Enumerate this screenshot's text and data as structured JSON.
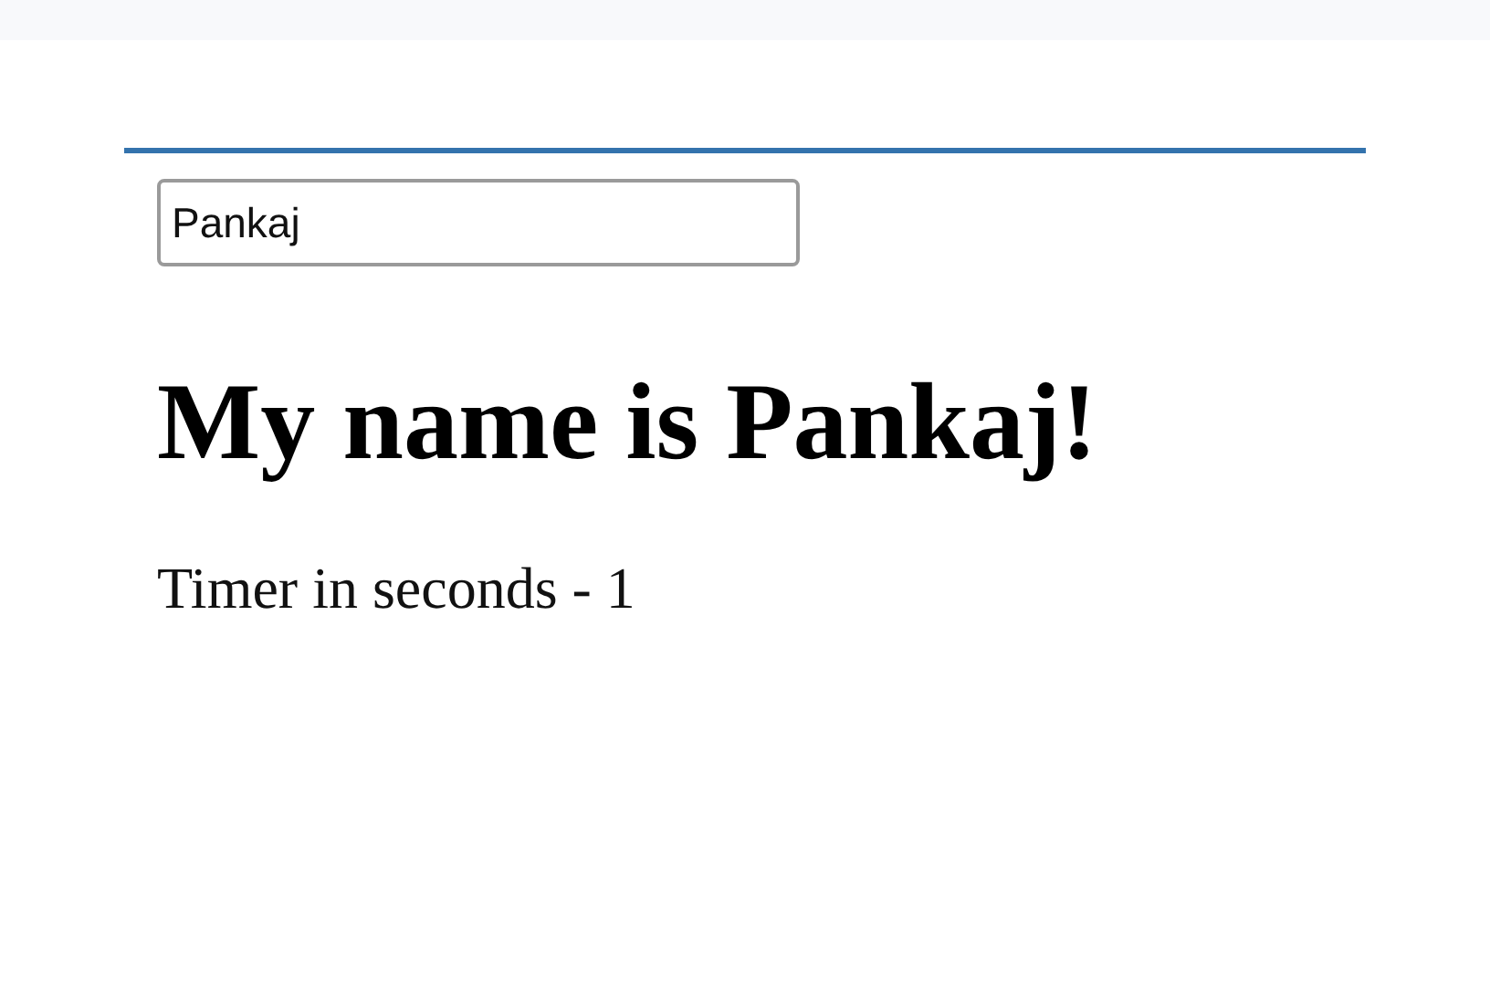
{
  "name_field": {
    "value": "Pankaj"
  },
  "heading": "My name is Pankaj!",
  "timer_text": "Timer in seconds - 1"
}
